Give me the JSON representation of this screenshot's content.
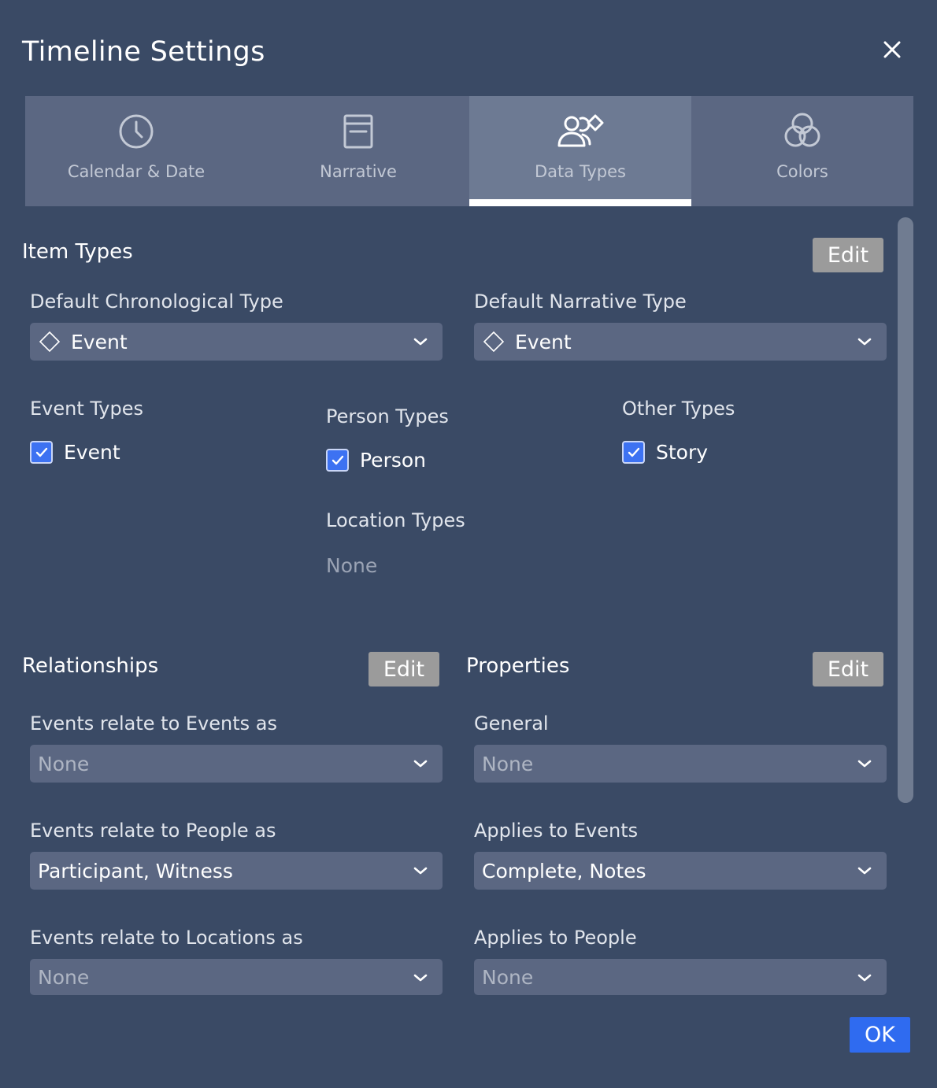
{
  "dialog": {
    "title": "Timeline Settings"
  },
  "tabs": [
    {
      "label": "Calendar & Date",
      "icon": "clock-icon"
    },
    {
      "label": "Narrative",
      "icon": "book-icon"
    },
    {
      "label": "Data Types",
      "icon": "people-diamond-icon",
      "active": true
    },
    {
      "label": "Colors",
      "icon": "color-circles-icon"
    }
  ],
  "item_types": {
    "title": "Item Types",
    "edit_label": "Edit",
    "default_chronological": {
      "label": "Default Chronological Type",
      "value": "Event"
    },
    "default_narrative": {
      "label": "Default Narrative Type",
      "value": "Event"
    },
    "event_types": {
      "title": "Event Types",
      "items": [
        {
          "label": "Event",
          "checked": true
        }
      ]
    },
    "person_types": {
      "title": "Person Types",
      "items": [
        {
          "label": "Person",
          "checked": true
        }
      ]
    },
    "other_types": {
      "title": "Other Types",
      "items": [
        {
          "label": "Story",
          "checked": true
        }
      ]
    },
    "location_types": {
      "title": "Location Types",
      "empty": "None"
    }
  },
  "relationships": {
    "title": "Relationships",
    "edit_label": "Edit",
    "fields": [
      {
        "label": "Events relate to Events as",
        "value": "None"
      },
      {
        "label": "Events relate to People as",
        "value": "Participant, Witness"
      },
      {
        "label": "Events relate to Locations as",
        "value": "None"
      }
    ]
  },
  "properties": {
    "title": "Properties",
    "edit_label": "Edit",
    "fields": [
      {
        "label": "General",
        "value": "None"
      },
      {
        "label": "Applies to Events",
        "value": "Complete, Notes"
      },
      {
        "label": "Applies to People",
        "value": "None"
      }
    ]
  },
  "footer": {
    "ok_label": "OK"
  },
  "colors": {
    "background": "#3a4a65",
    "tab_bar": "#5b6782",
    "tab_active": "#6d7a93",
    "field": "#5b6782",
    "edit_button": "#9b9b9b",
    "checkbox": "#3d72f2",
    "ok_button": "#2f6bf0"
  }
}
